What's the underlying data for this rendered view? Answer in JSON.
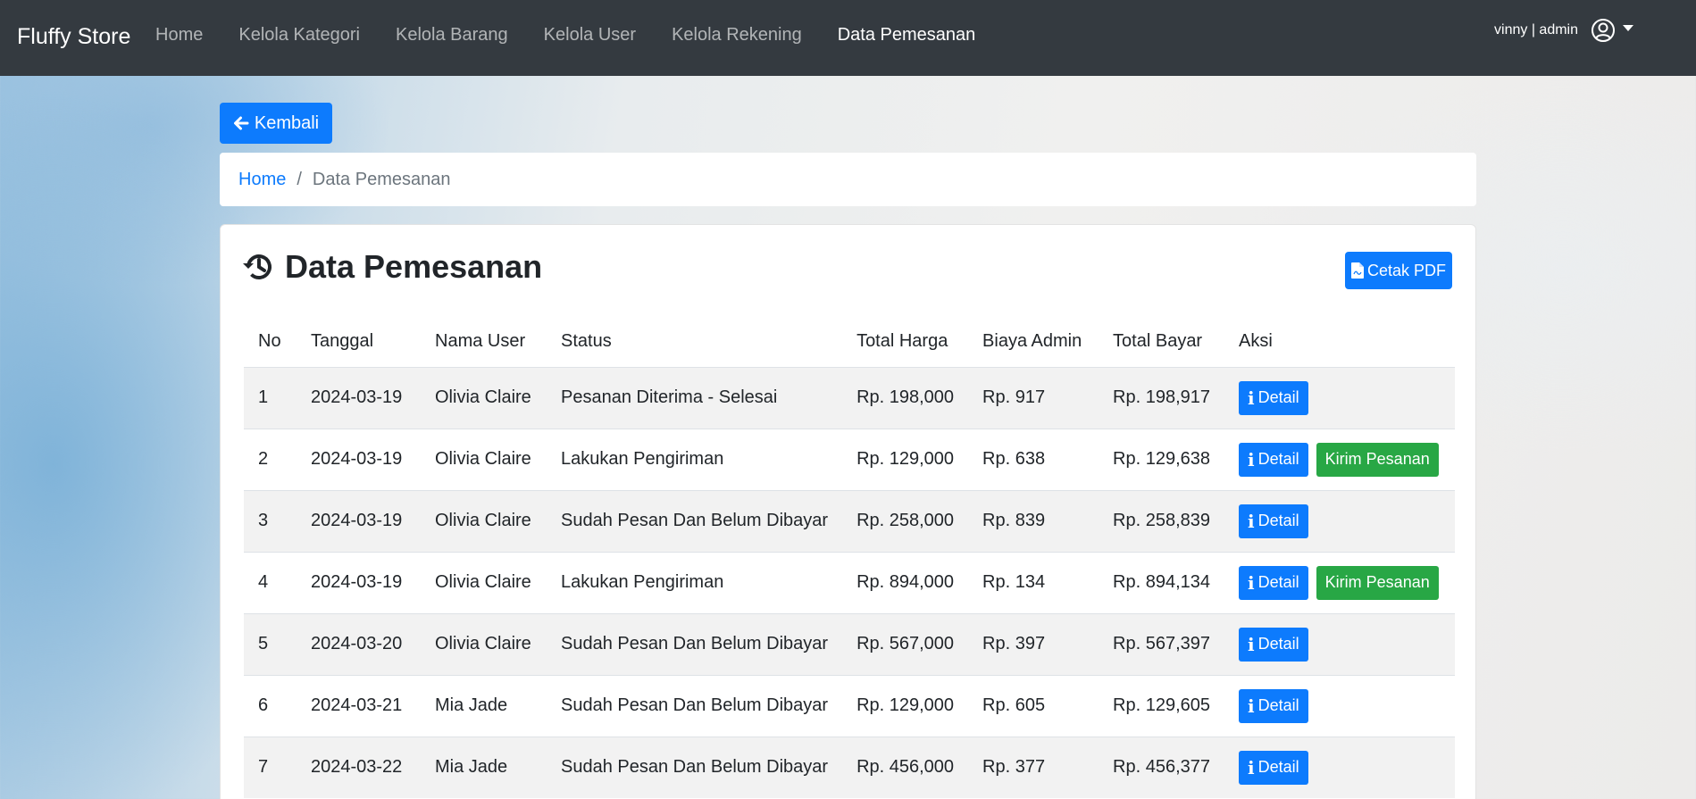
{
  "navbar": {
    "brand": "Fluffy Store",
    "links": [
      "Home",
      "Kelola Kategori",
      "Kelola Barang",
      "Kelola User",
      "Kelola Rekening",
      "Data Pemesanan"
    ],
    "user_label": "vinny | admin"
  },
  "back_button": "Kembali",
  "breadcrumb": {
    "home": "Home",
    "separator": "/",
    "current": "Data Pemesanan"
  },
  "card": {
    "title": "Data Pemesanan",
    "pdf_button": "Cetak PDF"
  },
  "table": {
    "headers": [
      "No",
      "Tanggal",
      "Nama User",
      "Status",
      "Total Harga",
      "Biaya Admin",
      "Total Bayar",
      "Aksi"
    ],
    "detail_label": "Detail",
    "kirim_label": "Kirim Pesanan",
    "rows": [
      {
        "no": "1",
        "tanggal": "2024-03-19",
        "nama": "Olivia Claire",
        "status": "Pesanan Diterima - Selesai",
        "harga": "Rp. 198,000",
        "admin": "Rp. 917",
        "bayar": "Rp. 198,917",
        "kirim": false
      },
      {
        "no": "2",
        "tanggal": "2024-03-19",
        "nama": "Olivia Claire",
        "status": "Lakukan Pengiriman",
        "harga": "Rp. 129,000",
        "admin": "Rp. 638",
        "bayar": "Rp. 129,638",
        "kirim": true
      },
      {
        "no": "3",
        "tanggal": "2024-03-19",
        "nama": "Olivia Claire",
        "status": "Sudah Pesan Dan Belum Dibayar",
        "harga": "Rp. 258,000",
        "admin": "Rp. 839",
        "bayar": "Rp. 258,839",
        "kirim": false
      },
      {
        "no": "4",
        "tanggal": "2024-03-19",
        "nama": "Olivia Claire",
        "status": "Lakukan Pengiriman",
        "harga": "Rp. 894,000",
        "admin": "Rp. 134",
        "bayar": "Rp. 894,134",
        "kirim": true
      },
      {
        "no": "5",
        "tanggal": "2024-03-20",
        "nama": "Olivia Claire",
        "status": "Sudah Pesan Dan Belum Dibayar",
        "harga": "Rp. 567,000",
        "admin": "Rp. 397",
        "bayar": "Rp. 567,397",
        "kirim": false
      },
      {
        "no": "6",
        "tanggal": "2024-03-21",
        "nama": "Mia Jade",
        "status": "Sudah Pesan Dan Belum Dibayar",
        "harga": "Rp. 129,000",
        "admin": "Rp. 605",
        "bayar": "Rp. 129,605",
        "kirim": false
      },
      {
        "no": "7",
        "tanggal": "2024-03-22",
        "nama": "Mia Jade",
        "status": "Sudah Pesan Dan Belum Dibayar",
        "harga": "Rp. 456,000",
        "admin": "Rp. 377",
        "bayar": "Rp. 456,377",
        "kirim": false
      }
    ]
  },
  "colors": {
    "navbar_bg": "#343a40",
    "primary": "#0d7bfd",
    "success": "#28a745"
  }
}
